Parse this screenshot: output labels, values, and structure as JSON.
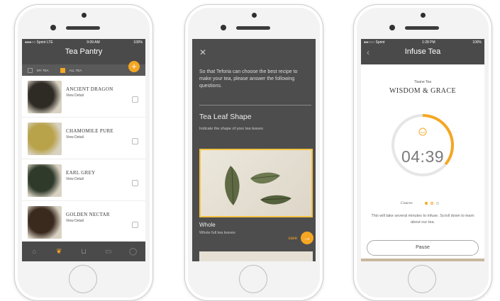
{
  "phone1": {
    "status": {
      "carrier": "●●●○○ Sprint  LTE",
      "time": "9:09 AM",
      "right": "100%"
    },
    "title": "Tea Pantry",
    "filters": {
      "my_tea": "MY TEA",
      "all_tea": "ALL TEA"
    },
    "add_icon": "plus-icon",
    "teas": [
      {
        "name": "ANCIENT DRAGON",
        "link": "View Detail",
        "color": "#2e2a24"
      },
      {
        "name": "CHAMOMILE PURE",
        "link": "View Detail",
        "color": "#b8a24a"
      },
      {
        "name": "EARL GREY",
        "link": "View Detail",
        "color": "#2f3a2a"
      },
      {
        "name": "GOLDEN NECTAR",
        "link": "View Detail",
        "color": "#3a2a1e"
      }
    ],
    "tabs": [
      "home-icon",
      "leaf-icon",
      "basket-icon",
      "chat-icon",
      "profile-icon"
    ]
  },
  "phone2": {
    "close_icon": "close-icon",
    "intro": "So that Teforia can choose the best recipe to make your tea, please answer the following questions.",
    "heading": "Tea Leaf Shape",
    "subheading": "Indicate the shape of your tea leaves",
    "option_title": "Whole",
    "option_sub": "Whole full tea leaves",
    "save_label": "save"
  },
  "phone3": {
    "status": {
      "carrier": "●●○○○ Sprint",
      "time": "1:28 PM",
      "right": "100%"
    },
    "title": "Infuse Tea",
    "kind": "Tisane Tea",
    "name": "WISDOM & GRACE",
    "time": "04:39",
    "progress_fraction": 0.36,
    "course_label": "Course:",
    "message": "This will take several minutes to infuse. Scroll down to learn about our tea.",
    "pause_label": "Pause",
    "accent": "#f5a623"
  }
}
